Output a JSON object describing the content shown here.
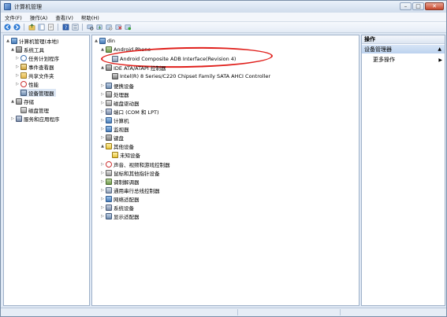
{
  "window": {
    "title": "计算机管理"
  },
  "menu": [
    {
      "label": "文件(F)"
    },
    {
      "label": "操作(A)"
    },
    {
      "label": "查看(V)"
    },
    {
      "label": "帮助(H)"
    }
  ],
  "left_tree": {
    "root": "计算机管理(本地)",
    "system_tools": "系统工具",
    "task_scheduler": "任务计划程序",
    "event_viewer": "事件查看器",
    "shared_folders": "共享文件夹",
    "performance": "性能",
    "device_manager": "设备管理器",
    "storage": "存储",
    "disk_management": "磁盘管理",
    "services_apps": "服务和应用程序"
  },
  "center_tree": {
    "root": "din",
    "android_phone": "Android Phone",
    "android_device": "Android Composite ADB Interface(Revision 4)",
    "ide": "IDE ATA/ATAPI 控制器",
    "ide_device": "Intel(R) 8 Series/C220 Chipset Family SATA AHCI Controller",
    "items": [
      {
        "label": "便携设备"
      },
      {
        "label": "处理器"
      },
      {
        "label": "磁盘驱动器"
      },
      {
        "label": "端口 (COM 和 LPT)"
      },
      {
        "label": "计算机"
      },
      {
        "label": "监视器"
      },
      {
        "label": "键盘"
      }
    ],
    "other_devices": "其他设备",
    "unknown_device": "未知设备",
    "items2": [
      {
        "label": "声音、视频和游戏控制器"
      },
      {
        "label": "鼠标和其他指针设备"
      },
      {
        "label": "调制解调器"
      },
      {
        "label": "通用串行总线控制器"
      },
      {
        "label": "网络适配器"
      },
      {
        "label": "系统设备"
      },
      {
        "label": "显示适配器"
      }
    ]
  },
  "actions": {
    "header": "操作",
    "section": "设备管理器",
    "more": "更多操作"
  }
}
